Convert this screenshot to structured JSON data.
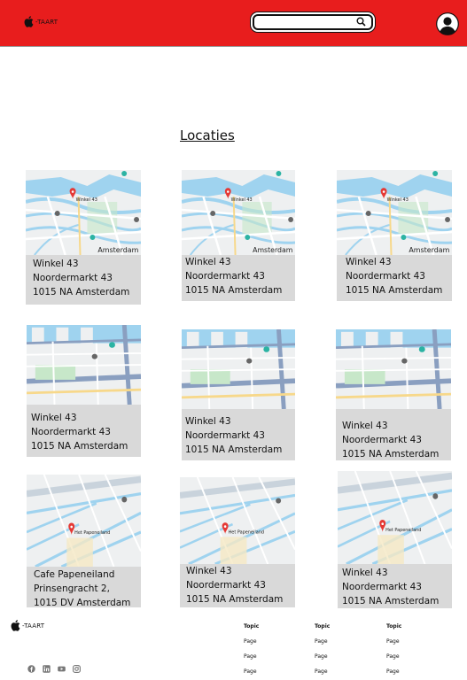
{
  "header": {
    "logo_text": "-TAART",
    "search_placeholder": ""
  },
  "main": {
    "title": "Locaties",
    "cards": [
      {
        "line1": "Winkel 43",
        "line2": "Noordermarkt 43",
        "line3": "1015 NA Amsterdam",
        "map_label": "Amsterdam"
      },
      {
        "line1": "Winkel 43",
        "line2": "Noordermarkt 43",
        "line3": "1015 NA Amsterdam",
        "map_label": "Amsterdam"
      },
      {
        "line1": "Winkel 43",
        "line2": "Noordermarkt 43",
        "line3": "1015 NA Amsterdam",
        "map_label": "Amsterdam"
      },
      {
        "line1": "Winkel 43",
        "line2": "Noordermarkt 43",
        "line3": "1015 NA Amsterdam",
        "map_label": ""
      },
      {
        "line1": "Winkel 43",
        "line2": "Noordermarkt 43",
        "line3": "1015 NA Amsterdam",
        "map_label": ""
      },
      {
        "line1": "Winkel 43",
        "line2": "Noordermarkt 43",
        "line3": "1015 NA Amsterdam",
        "map_label": ""
      },
      {
        "line1": "Cafe Papeneiland",
        "line2": "Prinsengracht 2,",
        "line3": "1015 DV Amsterdam",
        "map_label": ""
      },
      {
        "line1": "Winkel 43",
        "line2": "Noordermarkt 43",
        "line3": "1015 NA Amsterdam",
        "map_label": ""
      },
      {
        "line1": "Winkel 43",
        "line2": "Noordermarkt 43",
        "line3": "1015 NA Amsterdam",
        "map_label": ""
      }
    ],
    "map_pins": {
      "pin_a": "Winkel 43",
      "pin_c": "Het Papeneiland"
    }
  },
  "footer": {
    "logo_text": "-TAART",
    "columns": [
      {
        "topic": "Topic",
        "pages": [
          "Page",
          "Page",
          "Page"
        ]
      },
      {
        "topic": "Topic",
        "pages": [
          "Page",
          "Page",
          "Page"
        ]
      },
      {
        "topic": "Topic",
        "pages": [
          "Page",
          "Page",
          "Page"
        ]
      }
    ],
    "social_icons": [
      "facebook-icon",
      "linkedin-icon",
      "youtube-icon",
      "instagram-icon"
    ]
  }
}
